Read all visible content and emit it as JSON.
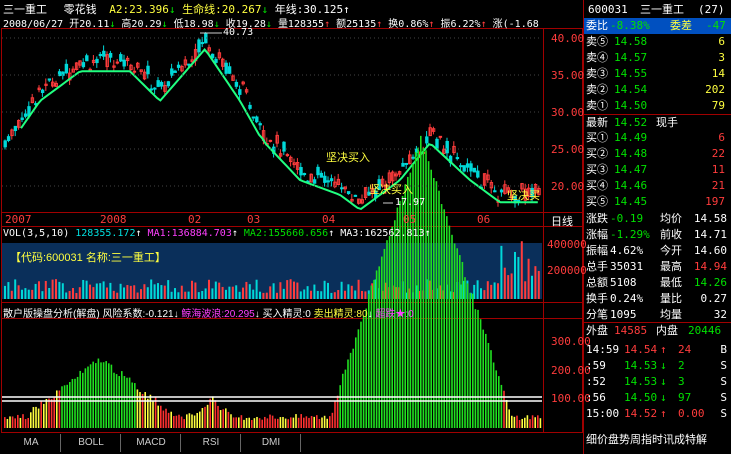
{
  "chart_header": {
    "name": "三一重工",
    "indicator": "零花钱",
    "a2": "A2:23.396",
    "life_line": "生命线:20.267",
    "year_line": "年线:30.125"
  },
  "quote_line": {
    "date": "2008/06/27",
    "open": "开20.11",
    "high": "高20.29",
    "low": "低18.98",
    "close": "收19.28",
    "volume": "量128355",
    "amount": "额25135",
    "turnover": "换0.86%",
    "amplitude": "振6.22%",
    "change": "涨(-1.68"
  },
  "price_axis": [
    "40.00",
    "35.00",
    "30.00",
    "25.00",
    "20.00"
  ],
  "annotations": {
    "high": "40.73",
    "low": "17.97",
    "buy1": "坚决买入",
    "buy2": "坚决买入",
    "buy3": "坚决买"
  },
  "time_axis": [
    "2007",
    "2008",
    "02",
    "03",
    "04",
    "05",
    "06"
  ],
  "period": "日线",
  "vol_header": {
    "label": "VOL(3,5,10)",
    "vol": "128355.172",
    "ma1": "MA1:136884.703",
    "ma2": "MA2:155660.656",
    "ma3": "MA3:162562.813"
  },
  "code_box": "【代码:600031 名称:三一重工】",
  "vol_axis": [
    "400000",
    "200000"
  ],
  "retail_header": {
    "title": "散户版操盘分析(解盘)",
    "risk": "风险系数:-0.121",
    "shark": "鲸海波浪:20.295",
    "buy": "买入精灵:0",
    "sell": "卖出精灵:80",
    "jump": "超跌★:0"
  },
  "retail_axis": [
    "300.00",
    "200.00",
    "100.00"
  ],
  "tabs": [
    "MA",
    "BOLL",
    "MACD",
    "RSI",
    "DMI"
  ],
  "right_panel": {
    "code": "600031",
    "name": "三一重工",
    "count": "(27)",
    "weibi_label": "委比",
    "weibi": "-8.38%",
    "weicha_label": "委差",
    "weicha": "-47",
    "asks": [
      {
        "label": "卖⑤",
        "price": "14.58",
        "vol": "6"
      },
      {
        "label": "卖④",
        "price": "14.57",
        "vol": "3"
      },
      {
        "label": "卖③",
        "price": "14.55",
        "vol": "14"
      },
      {
        "label": "卖②",
        "price": "14.54",
        "vol": "202"
      },
      {
        "label": "卖①",
        "price": "14.50",
        "vol": "79"
      }
    ],
    "last_label": "最新",
    "last": "14.52",
    "hand_label": "现手",
    "bids": [
      {
        "label": "买①",
        "price": "14.49",
        "vol": "6"
      },
      {
        "label": "买②",
        "price": "14.48",
        "vol": "22"
      },
      {
        "label": "买③",
        "price": "14.47",
        "vol": "11"
      },
      {
        "label": "买④",
        "price": "14.46",
        "vol": "21"
      },
      {
        "label": "买⑤",
        "price": "14.45",
        "vol": "197"
      }
    ],
    "stats": [
      {
        "l1": "涨跌",
        "v1": "-0.19",
        "l2": "均价",
        "v2": "14.58"
      },
      {
        "l1": "涨幅",
        "v1": "-1.29%",
        "l2": "前收",
        "v2": "14.71"
      },
      {
        "l1": "振幅",
        "v1": "4.62%",
        "l2": "今开",
        "v2": "14.60"
      },
      {
        "l1": "总手",
        "v1": "35031",
        "l2": "最高",
        "v2": "14.94"
      },
      {
        "l1": "总额",
        "v1": "5108",
        "l2": "最低",
        "v2": "14.26"
      },
      {
        "l1": "换手",
        "v1": "0.24%",
        "l2": "量比",
        "v2": "0.27"
      },
      {
        "l1": "分笔",
        "v1": "1095",
        "l2": "均量",
        "v2": "32"
      }
    ],
    "outer_label": "外盘",
    "outer": "14585",
    "inner_label": "内盘",
    "inner": "20446",
    "ticks": [
      {
        "time": "14:59",
        "price": "14.54",
        "dir": "↑",
        "vol": "24",
        "side": "B"
      },
      {
        "time": ":59",
        "price": "14.53",
        "dir": "↓",
        "vol": "2",
        "side": "S"
      },
      {
        "time": ":52",
        "price": "14.53",
        "dir": "↓",
        "vol": "3",
        "side": "S"
      },
      {
        "time": ":56",
        "price": "14.50",
        "dir": "↓",
        "vol": "97",
        "side": "S"
      },
      {
        "time": "15:00",
        "price": "14.52",
        "dir": "↑",
        "vol": "0.00",
        "side": "S"
      }
    ],
    "footer": "细价盘势周指时讯成特解"
  }
}
